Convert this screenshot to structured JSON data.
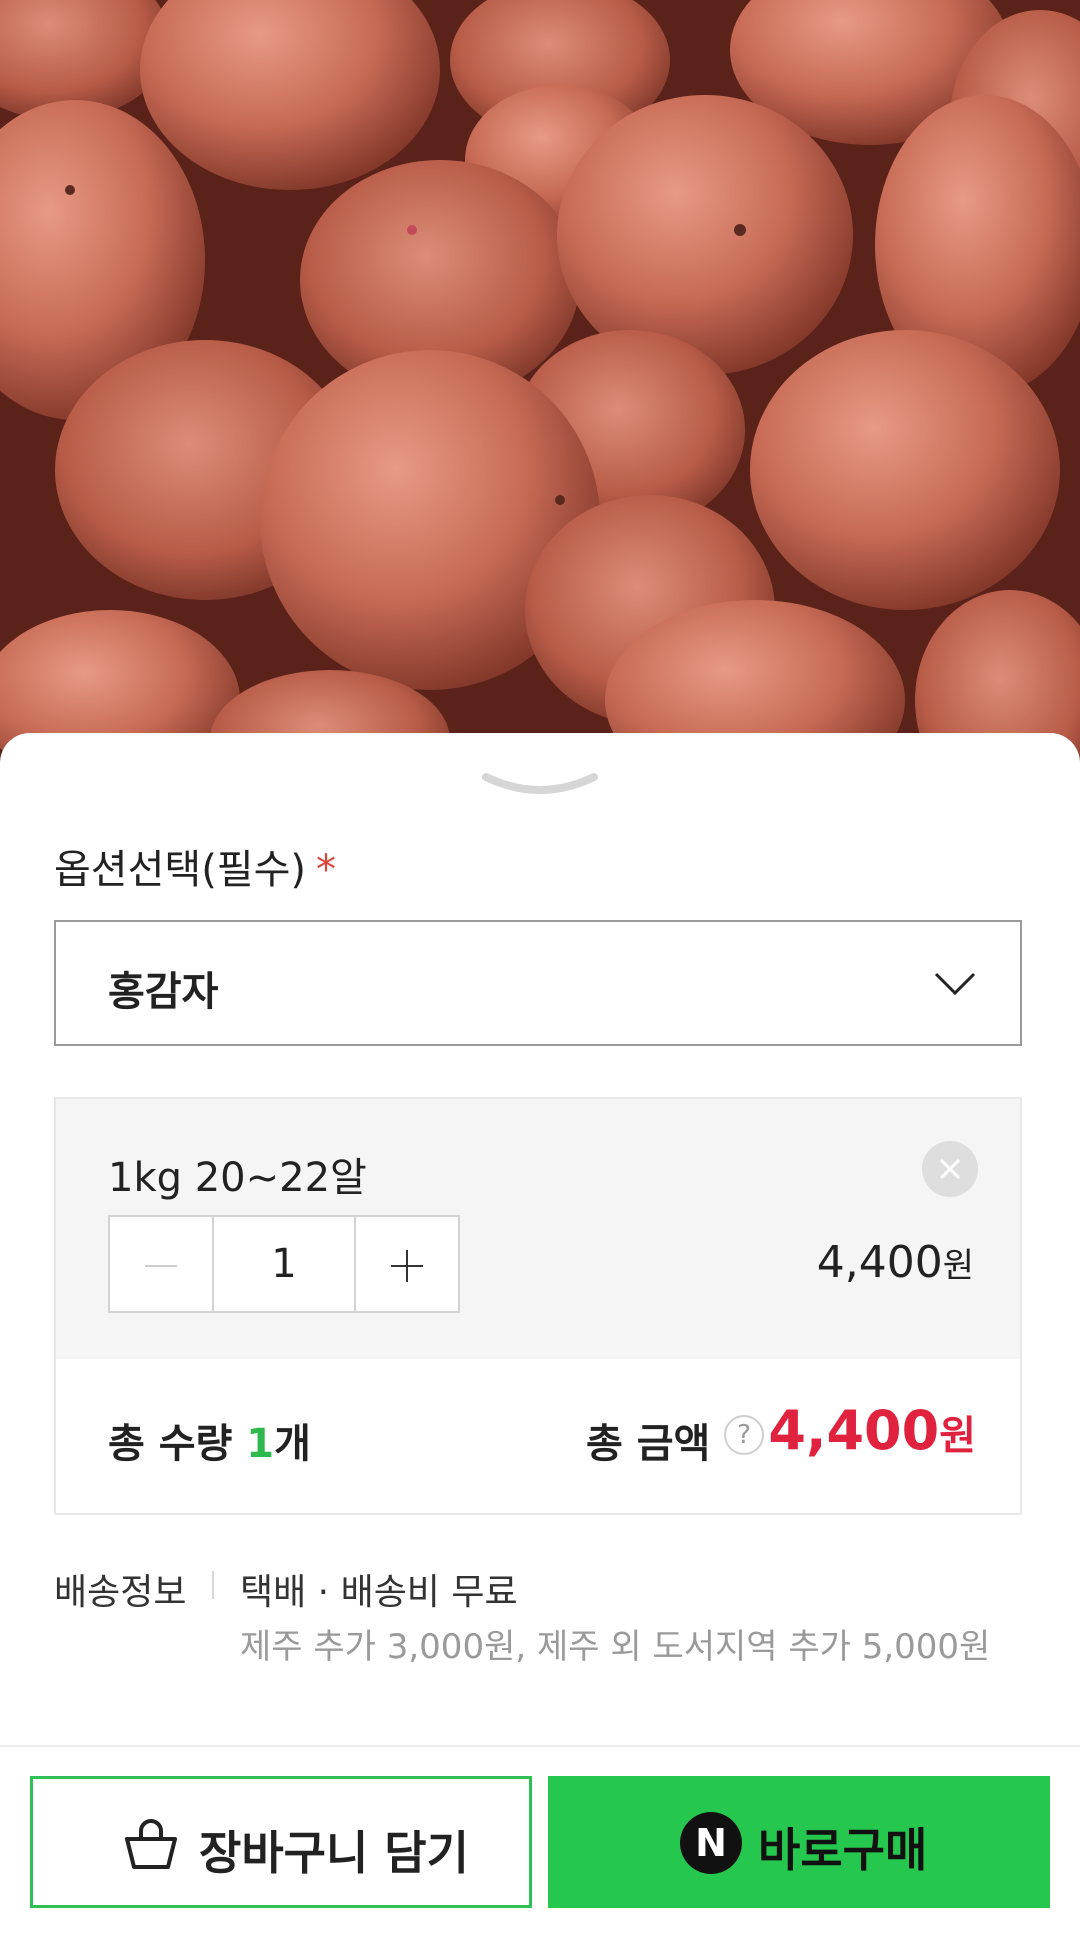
{
  "product_image": {
    "subject": "red potatoes"
  },
  "option": {
    "label": "옵션선택(필수)",
    "required_mark": "*",
    "selected_value": "홍감자"
  },
  "item": {
    "name": "1kg 20~22알",
    "quantity": "1",
    "price": "4,400",
    "price_unit": "원"
  },
  "summary": {
    "total_qty_prefix": "총 수량",
    "total_qty_num": "1",
    "total_qty_suffix": "개",
    "total_amount_label": "총 금액",
    "help_glyph": "?",
    "total_amount": "4,400",
    "total_amount_unit": "원"
  },
  "shipping": {
    "title": "배송정보",
    "main": "택배 · 배송비 무료",
    "extra": "제주 추가 3,000원, 제주 외 도서지역 추가 5,000원"
  },
  "actions": {
    "cart_label": "장바구니 담기",
    "buy_badge": "N",
    "buy_label": "바로구매"
  },
  "colors": {
    "accent_green": "#25c74e",
    "price_red": "#e0223f",
    "required_red": "#d9473a"
  }
}
